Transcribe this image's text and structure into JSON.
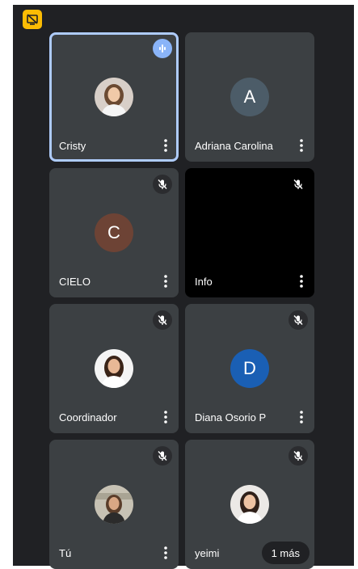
{
  "participants": [
    {
      "name": "Cristy",
      "speaking": true,
      "muted": false,
      "avatar": "photo",
      "avatar_colors": {
        "bg": "#d8cfc8",
        "hair": "#6b4a32",
        "face": "#f0c9a8",
        "shirt": "#f5f5f5"
      }
    },
    {
      "name": "Adriana Carolina",
      "muted": false,
      "avatar": "letter",
      "initial": "A",
      "avatar_color": "#4c5c68"
    },
    {
      "name": "CIELO",
      "muted": true,
      "avatar": "letter",
      "initial": "C",
      "avatar_color": "#6d4335"
    },
    {
      "name": "Info",
      "muted": true,
      "avatar": "none",
      "tile_color": "#000000"
    },
    {
      "name": "Coordinador",
      "muted": true,
      "avatar": "photo",
      "avatar_colors": {
        "bg": "#f4f4f4",
        "hair": "#3a2418",
        "face": "#e8b896",
        "shirt": "#ffffff"
      }
    },
    {
      "name": "Diana Osorio P",
      "muted": true,
      "avatar": "letter",
      "initial": "D",
      "avatar_color": "#1a5fb4"
    },
    {
      "name": "Tú",
      "muted": true,
      "avatar": "photo",
      "avatar_colors": {
        "bg": "#c7c2b4",
        "hair": "#5a3d2a",
        "face": "#d9a784",
        "shirt": "#2b2b2b"
      }
    },
    {
      "name": "yeimi",
      "muted": true,
      "avatar": "photo",
      "avatar_colors": {
        "bg": "#ece9e6",
        "hair": "#2f2019",
        "face": "#eec3a3",
        "shirt": "#ffffff"
      }
    }
  ],
  "more_button": "1 más",
  "icons": {
    "top": "screen-share-off-icon",
    "speaking": "audio-level-icon",
    "muted": "mic-off-icon",
    "options": "more-vert-icon"
  },
  "colors": {
    "background": "#202124",
    "tile": "#3c4043",
    "active_border": "#aecbfa",
    "speaking_badge": "#8ab4f8",
    "top_badge": "#fbbc04"
  }
}
